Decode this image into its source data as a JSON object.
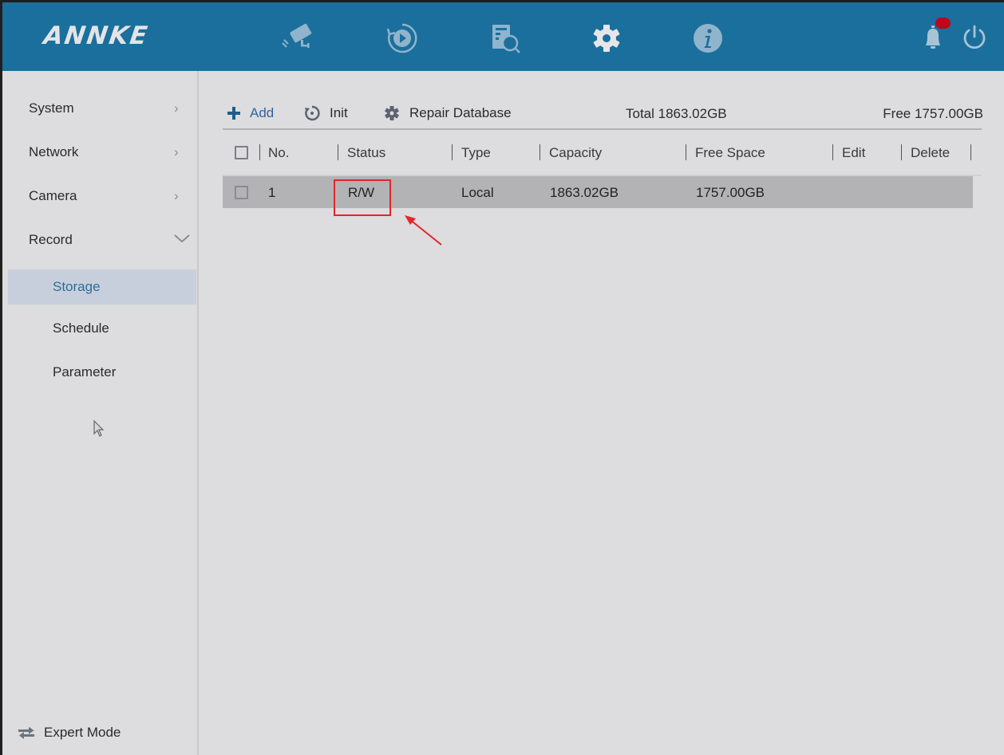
{
  "header": {
    "logo": "ANNKE",
    "nav_icons": [
      {
        "name": "live-view-camera-icon",
        "active": false
      },
      {
        "name": "playback-icon",
        "active": false
      },
      {
        "name": "search-file-icon",
        "active": false
      },
      {
        "name": "settings-gear-icon",
        "active": true
      },
      {
        "name": "info-icon",
        "active": false
      }
    ],
    "notification_icon": "bell-icon",
    "notification_badge_color": "#c0061a",
    "power_icon": "power-icon",
    "bar_color": "#1b6f9c"
  },
  "sidebar": {
    "items": [
      {
        "label": "System",
        "chevron": "›"
      },
      {
        "label": "Network",
        "chevron": "›"
      },
      {
        "label": "Camera",
        "chevron": "›"
      },
      {
        "label": "Record",
        "chevron": "⌄",
        "expanded": true
      }
    ],
    "subitems": [
      {
        "label": "Storage",
        "active": true
      },
      {
        "label": "Schedule",
        "active": false
      },
      {
        "label": "Parameter",
        "active": false
      }
    ],
    "expert_mode": "Expert Mode"
  },
  "toolbar": {
    "add_label": "Add",
    "init_label": "Init",
    "repair_label": "Repair Database",
    "total": "Total 1863.02GB",
    "free": "Free 1757.00GB"
  },
  "table": {
    "columns": [
      "No.",
      "Status",
      "Type",
      "Capacity",
      "Free Space",
      "Edit",
      "Delete"
    ],
    "rows": [
      {
        "no": "1",
        "status": "R/W",
        "type": "Local",
        "capacity": "1863.02GB",
        "free_space": "1757.00GB",
        "edit": "",
        "delete": ""
      }
    ]
  },
  "annotation": {
    "highlight_target": "R/W",
    "color": "#e2262a"
  }
}
